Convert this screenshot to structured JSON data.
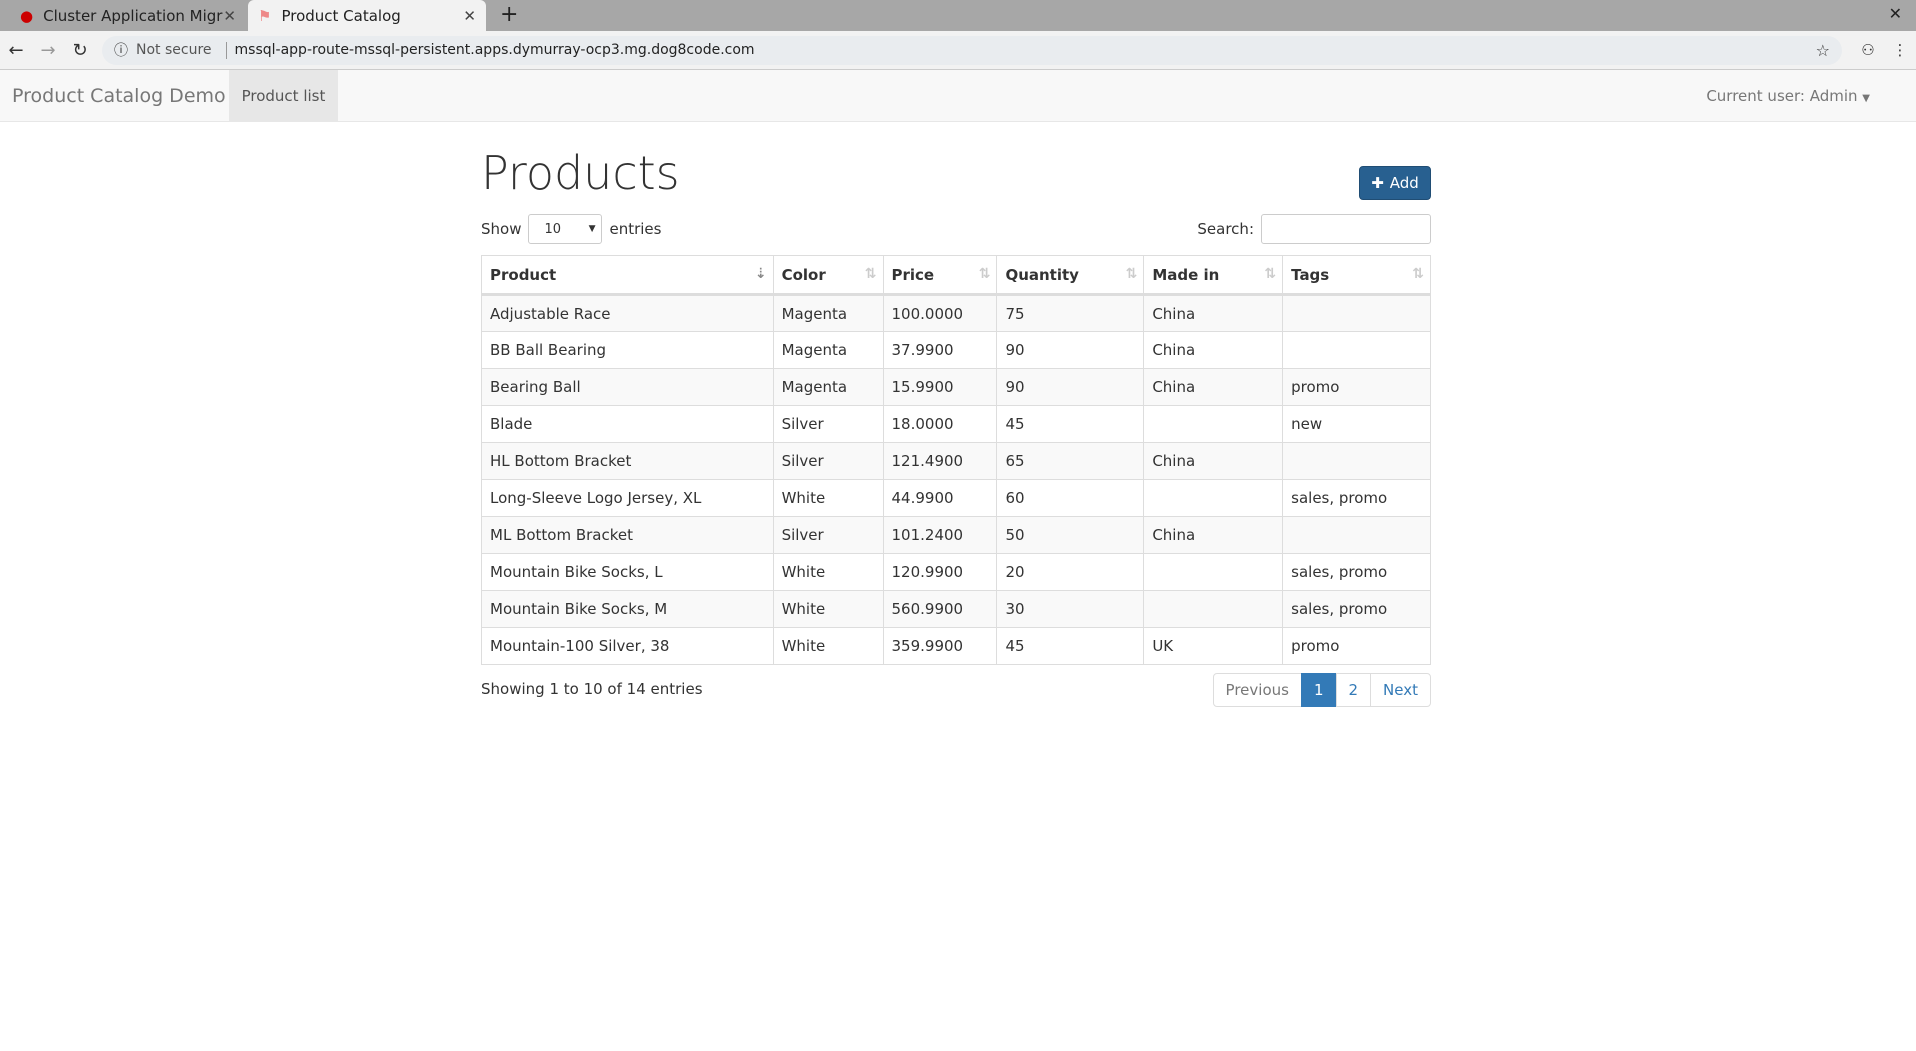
{
  "browser": {
    "tabs": [
      {
        "title": "Cluster Application Migration",
        "icon": "redhat-icon"
      },
      {
        "title": "Product Catalog",
        "icon": "app-icon",
        "active": true
      }
    ],
    "not_secure": "Not secure",
    "url": "mssql-app-route-mssql-persistent.apps.dymurray-ocp3.mg.dog8code.com"
  },
  "navbar": {
    "brand": "Product Catalog Demo",
    "link": "Product list",
    "user": "Current user: Admin"
  },
  "page": {
    "title": "Products",
    "add_label": "Add",
    "show_label": "Show",
    "entries_value": "10",
    "entries_label": "entries",
    "search_label": "Search:",
    "search_value": ""
  },
  "table": {
    "columns": [
      "Product",
      "Color",
      "Price",
      "Quantity",
      "Made in",
      "Tags"
    ],
    "rows": [
      [
        "Adjustable Race",
        "Magenta",
        "100.0000",
        "75",
        "China",
        ""
      ],
      [
        "BB Ball Bearing",
        "Magenta",
        "37.9900",
        "90",
        "China",
        ""
      ],
      [
        "Bearing Ball",
        "Magenta",
        "15.9900",
        "90",
        "China",
        "promo"
      ],
      [
        "Blade",
        "Silver",
        "18.0000",
        "45",
        "",
        "new"
      ],
      [
        "HL Bottom Bracket",
        "Silver",
        "121.4900",
        "65",
        "China",
        ""
      ],
      [
        "Long-Sleeve Logo Jersey, XL",
        "White",
        "44.9900",
        "60",
        "",
        "sales, promo"
      ],
      [
        "ML Bottom Bracket",
        "Silver",
        "101.2400",
        "50",
        "China",
        ""
      ],
      [
        "Mountain Bike Socks, L",
        "White",
        "120.9900",
        "20",
        "",
        "sales, promo"
      ],
      [
        "Mountain Bike Socks, M",
        "White",
        "560.9900",
        "30",
        "",
        "sales, promo"
      ],
      [
        "Mountain-100 Silver, 38",
        "White",
        "359.9900",
        "45",
        "UK",
        "promo"
      ]
    ]
  },
  "footer": {
    "info": "Showing 1 to 10 of 14 entries",
    "pages": [
      "Previous",
      "1",
      "2",
      "Next"
    ]
  },
  "colors": {
    "primary": "#337ab7",
    "add_button": "#286090"
  }
}
